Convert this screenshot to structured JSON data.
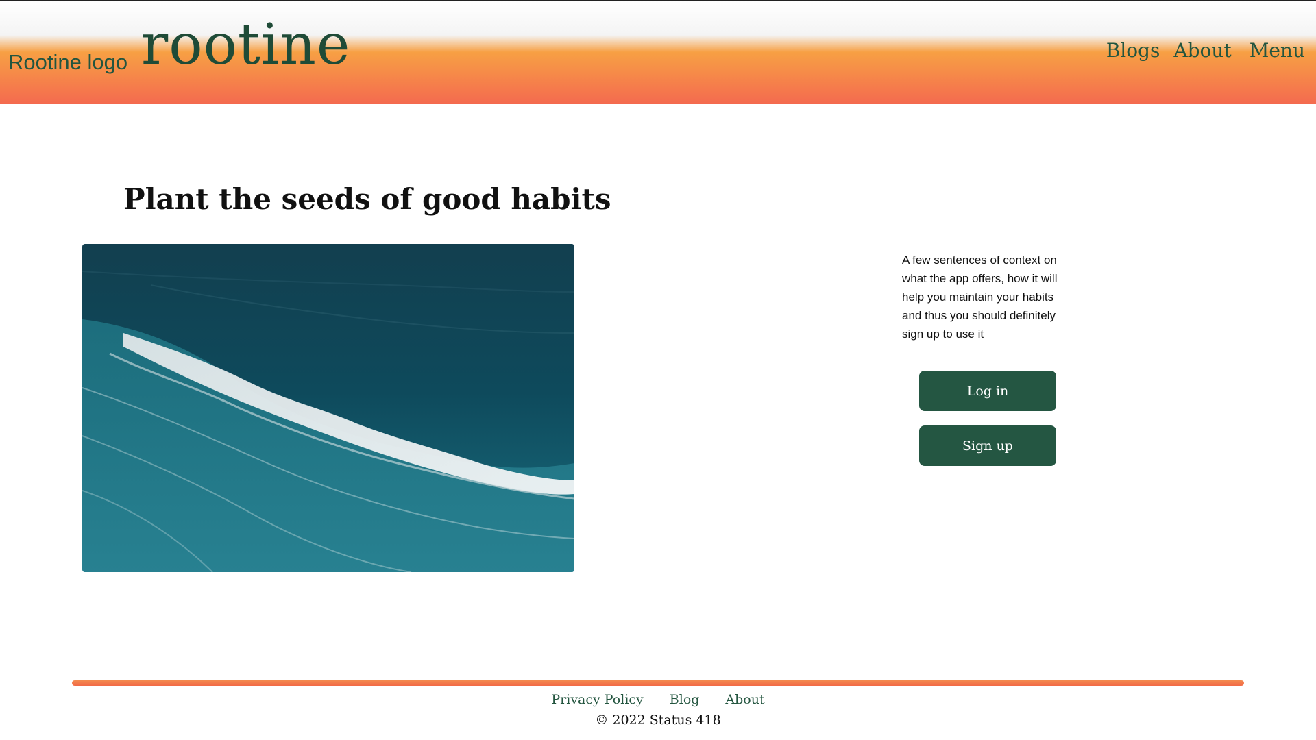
{
  "header": {
    "logo_alt": "Rootine logo",
    "brand": "rootine",
    "nav": [
      "Blogs",
      "About",
      "Menu"
    ]
  },
  "main": {
    "headline": "Plant the seeds of good habits",
    "hero_image": "ocean-wave-aerial-photo",
    "context": "A few sentences of context on what the app offers, how it will help you maintain your habits and thus you should definitely sign up to use it",
    "login_label": "Log in",
    "signup_label": "Sign up"
  },
  "footer": {
    "links": [
      "Privacy Policy",
      "Blog",
      "About"
    ],
    "copyright": "© 2022 Status 418"
  },
  "colors": {
    "brand_green": "#245642",
    "gradient_orange": "#f7a044",
    "gradient_red": "#f46a4f"
  }
}
